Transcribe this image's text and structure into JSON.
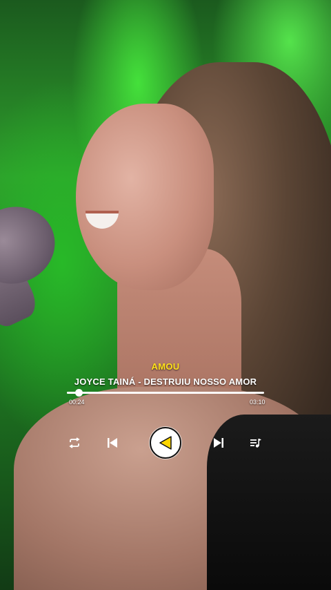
{
  "track": {
    "song_title": "AMOU",
    "artist_line": "JOYCE TAINÁ - DESTRUIU NOSSO AMOR"
  },
  "progress": {
    "elapsed": "00:24",
    "duration": "03:10",
    "fraction": 0.06
  },
  "controls": {
    "repeat_icon": "repeat-icon",
    "previous_icon": "skip-previous-icon",
    "play_icon": "play-icon",
    "next_icon": "skip-next-icon",
    "playlist_icon": "playlist-icon"
  },
  "colors": {
    "title": "#ffe11a",
    "text": "#ffffff",
    "play_accent": "#ffd600",
    "play_ring": "#111111"
  }
}
